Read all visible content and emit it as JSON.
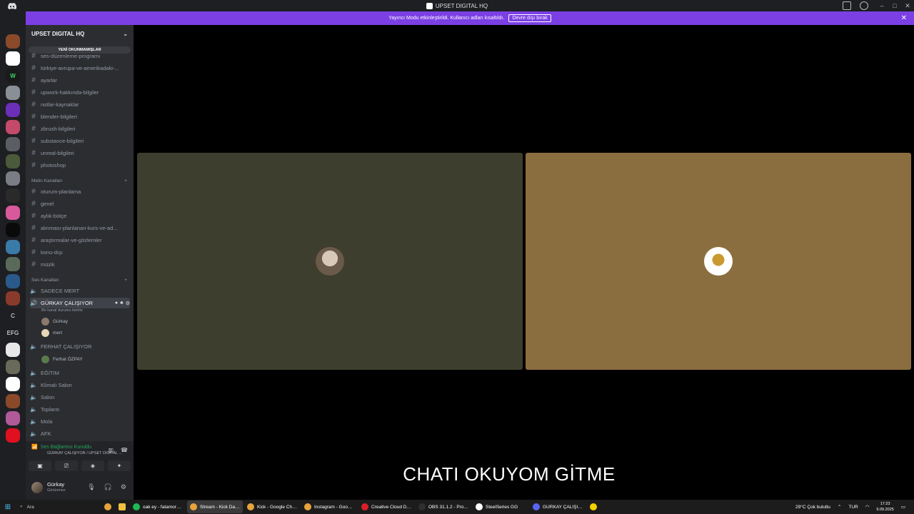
{
  "titlebar": {
    "title": "UPSET DIGITAL HQ"
  },
  "banner": {
    "text": "Yayıncı Modu etkinleştirildi. Kullanıcı adları kısaltıldı.",
    "button": "Devre dışı bırak"
  },
  "server": {
    "name": "UPSET DIGITAL HQ",
    "unread_pill": "YENİ OKUNMAMIŞLAR"
  },
  "text_channels_top": [
    "ses-düzenleme-programı",
    "türkiye-avrupa-ve-amerikadaki-...",
    "ayarlar",
    "upwork-hakkında-bilgiler",
    "notlar-kaynaklar",
    "blender-bilgileri",
    "zbrush-bilgileri",
    "substance-bilgileri",
    "unreal-bilgileri",
    "photoshop"
  ],
  "category_text": "Metin Kanalları",
  "text_channels": [
    "oturum-planlama",
    "genel",
    "aylık-bütçe",
    "alınması-planlanan-kurs-ve-ad...",
    "araştırmalar-ve-gözlemler",
    "konu-dışı",
    "müzik"
  ],
  "category_voice": "Ses Kanalları",
  "voice_channels": {
    "sadece_mert": "SADECE MERT",
    "gurkay": "GÜRKAY ÇALIŞIYOR",
    "gurkay_status": "Bir kanal durumu belirle",
    "gurkay_members": [
      "Gürkay",
      "mert"
    ],
    "ferhat": "FERHAT ÇALIŞIYOR",
    "ferhat_members": [
      "Ferhat ÖZPAY"
    ],
    "others": [
      "EĞİTİM",
      "Klimalı Salon",
      "Salon",
      "Toplantı",
      "Mola",
      "AFK"
    ]
  },
  "rail_text": {
    "c": "C",
    "efg": "EFG"
  },
  "voice_panel": {
    "status": "Ses Bağlantısı Kuruldu",
    "sub": "GÜRKAY ÇALIŞIYOR / UPSET DIGITAL ..."
  },
  "user_panel": {
    "name": "Gürkay",
    "status": "Görünmez"
  },
  "caption": "CHATI OKUYOM GİTME",
  "colors": {
    "tile_left": "#3e3e2e",
    "tile_right": "#8b6e3f",
    "banner": "#7b3fe4"
  },
  "taskbar": {
    "search": "Ara",
    "apps": [
      {
        "label": "oak ey - fatamorga...",
        "color": "#1db954"
      },
      {
        "label": "Stream - Kick Dash...",
        "color": "#e8a33a",
        "active": true
      },
      {
        "label": "Kick - Google Chro...",
        "color": "#e8a33a"
      },
      {
        "label": "Instagram - Google...",
        "color": "#e8a33a"
      },
      {
        "label": "Creative Cloud Des...",
        "color": "#da1f26"
      },
      {
        "label": "OBS 31.1.2 - Profil: ...",
        "color": "#302e31"
      },
      {
        "label": "SteelSeries GG",
        "color": "#ffffff"
      },
      {
        "label": "GÜRKAY ÇALIŞIYO...",
        "color": "#5865f2"
      }
    ],
    "weather": "29°C  Çok bulutlu",
    "lang": "TUR",
    "time": "17:23",
    "date": "9.09.2025"
  }
}
